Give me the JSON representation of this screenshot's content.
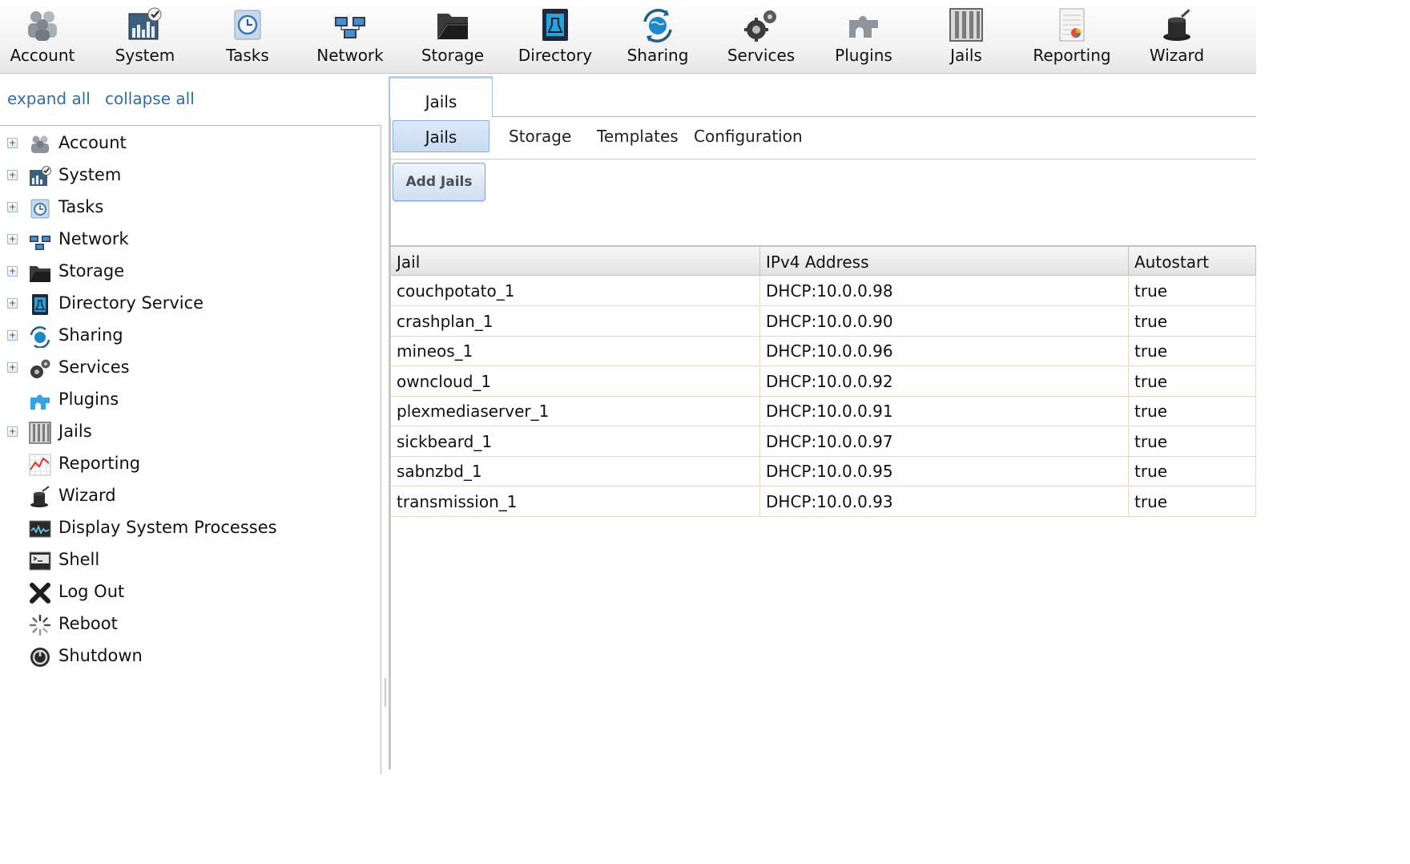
{
  "toolbar": {
    "items": [
      {
        "label": "Account",
        "icon": "account-icon"
      },
      {
        "label": "System",
        "icon": "system-icon"
      },
      {
        "label": "Tasks",
        "icon": "tasks-icon"
      },
      {
        "label": "Network",
        "icon": "network-icon"
      },
      {
        "label": "Storage",
        "icon": "storage-icon"
      },
      {
        "label": "Directory",
        "icon": "directory-icon"
      },
      {
        "label": "Sharing",
        "icon": "sharing-icon"
      },
      {
        "label": "Services",
        "icon": "services-icon"
      },
      {
        "label": "Plugins",
        "icon": "plugins-icon"
      },
      {
        "label": "Jails",
        "icon": "jails-icon"
      },
      {
        "label": "Reporting",
        "icon": "reporting-icon"
      },
      {
        "label": "Wizard",
        "icon": "wizard-icon"
      }
    ]
  },
  "nav": {
    "expand_all": "expand all",
    "collapse_all": "collapse all",
    "expander_symbol": "+",
    "items": [
      {
        "label": "Account",
        "expandable": true,
        "icon": "account-icon"
      },
      {
        "label": "System",
        "expandable": true,
        "icon": "system-icon"
      },
      {
        "label": "Tasks",
        "expandable": true,
        "icon": "tasks-icon"
      },
      {
        "label": "Network",
        "expandable": true,
        "icon": "network-icon"
      },
      {
        "label": "Storage",
        "expandable": true,
        "icon": "storage-icon"
      },
      {
        "label": "Directory Service",
        "expandable": true,
        "icon": "directory-icon"
      },
      {
        "label": "Sharing",
        "expandable": true,
        "icon": "sharing-icon"
      },
      {
        "label": "Services",
        "expandable": true,
        "icon": "services-icon"
      },
      {
        "label": "Plugins",
        "expandable": false,
        "icon": "plugins-icon"
      },
      {
        "label": "Jails",
        "expandable": true,
        "icon": "jails-icon"
      },
      {
        "label": "Reporting",
        "expandable": false,
        "icon": "reporting-icon"
      },
      {
        "label": "Wizard",
        "expandable": false,
        "icon": "wizard-icon"
      },
      {
        "label": "Display System Processes",
        "expandable": false,
        "icon": "processes-icon"
      },
      {
        "label": "Shell",
        "expandable": false,
        "icon": "shell-icon"
      },
      {
        "label": "Log Out",
        "expandable": false,
        "icon": "logout-icon"
      },
      {
        "label": "Reboot",
        "expandable": false,
        "icon": "reboot-icon"
      },
      {
        "label": "Shutdown",
        "expandable": false,
        "icon": "shutdown-icon"
      }
    ]
  },
  "main": {
    "tab": "Jails",
    "subtabs": [
      "Jails",
      "Storage",
      "Templates",
      "Configuration"
    ],
    "active_subtab": "Jails",
    "add_button": "Add Jails",
    "table": {
      "columns": [
        "Jail",
        "IPv4 Address",
        "Autostart"
      ],
      "rows": [
        [
          "couchpotato_1",
          "DHCP:10.0.0.98",
          "true"
        ],
        [
          "crashplan_1",
          "DHCP:10.0.0.90",
          "true"
        ],
        [
          "mineos_1",
          "DHCP:10.0.0.96",
          "true"
        ],
        [
          "owncloud_1",
          "DHCP:10.0.0.92",
          "true"
        ],
        [
          "plexmediaserver_1",
          "DHCP:10.0.0.91",
          "true"
        ],
        [
          "sickbeard_1",
          "DHCP:10.0.0.97",
          "true"
        ],
        [
          "sabnzbd_1",
          "DHCP:10.0.0.95",
          "true"
        ],
        [
          "transmission_1",
          "DHCP:10.0.0.93",
          "true"
        ]
      ]
    }
  },
  "colors": {
    "link": "#2f6ea5",
    "tab_border": "#9fbfe4",
    "active_subtab_bg": "#c6dbf2",
    "grid_line": "#e8d7c0"
  }
}
